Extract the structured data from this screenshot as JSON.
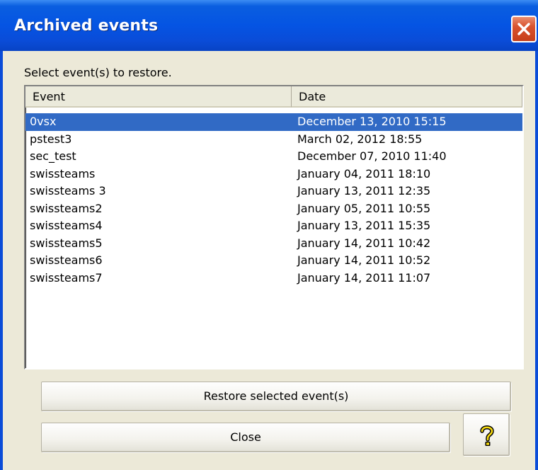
{
  "window": {
    "title": "Archived events",
    "close_icon": "close-icon"
  },
  "prompt": "Select event(s) to restore.",
  "list": {
    "columns": {
      "event": "Event",
      "date": "Date"
    },
    "rows": [
      {
        "event": "0vsx",
        "date": "December 13, 2010 15:15",
        "selected": true
      },
      {
        "event": "pstest3",
        "date": "March 02, 2012 18:55",
        "selected": false
      },
      {
        "event": "sec_test",
        "date": "December 07, 2010 11:40",
        "selected": false
      },
      {
        "event": "swissteams",
        "date": "January 04, 2011 18:10",
        "selected": false
      },
      {
        "event": "swissteams 3",
        "date": "January 13, 2011 12:35",
        "selected": false
      },
      {
        "event": "swissteams2",
        "date": "January 05, 2011 10:55",
        "selected": false
      },
      {
        "event": "swissteams4",
        "date": "January 13, 2011 15:35",
        "selected": false
      },
      {
        "event": "swissteams5",
        "date": "January 14, 2011 10:42",
        "selected": false
      },
      {
        "event": "swissteams6",
        "date": "January 14, 2011 10:52",
        "selected": false
      },
      {
        "event": "swissteams7",
        "date": "January 14, 2011 11:07",
        "selected": false
      }
    ]
  },
  "buttons": {
    "restore": "Restore selected event(s)",
    "close": "Close",
    "help_icon": "help-icon"
  },
  "colors": {
    "titlebar": "#0554e3",
    "selection": "#316ac5",
    "dialog_bg": "#ece9d8",
    "close_button": "#d9532e"
  }
}
